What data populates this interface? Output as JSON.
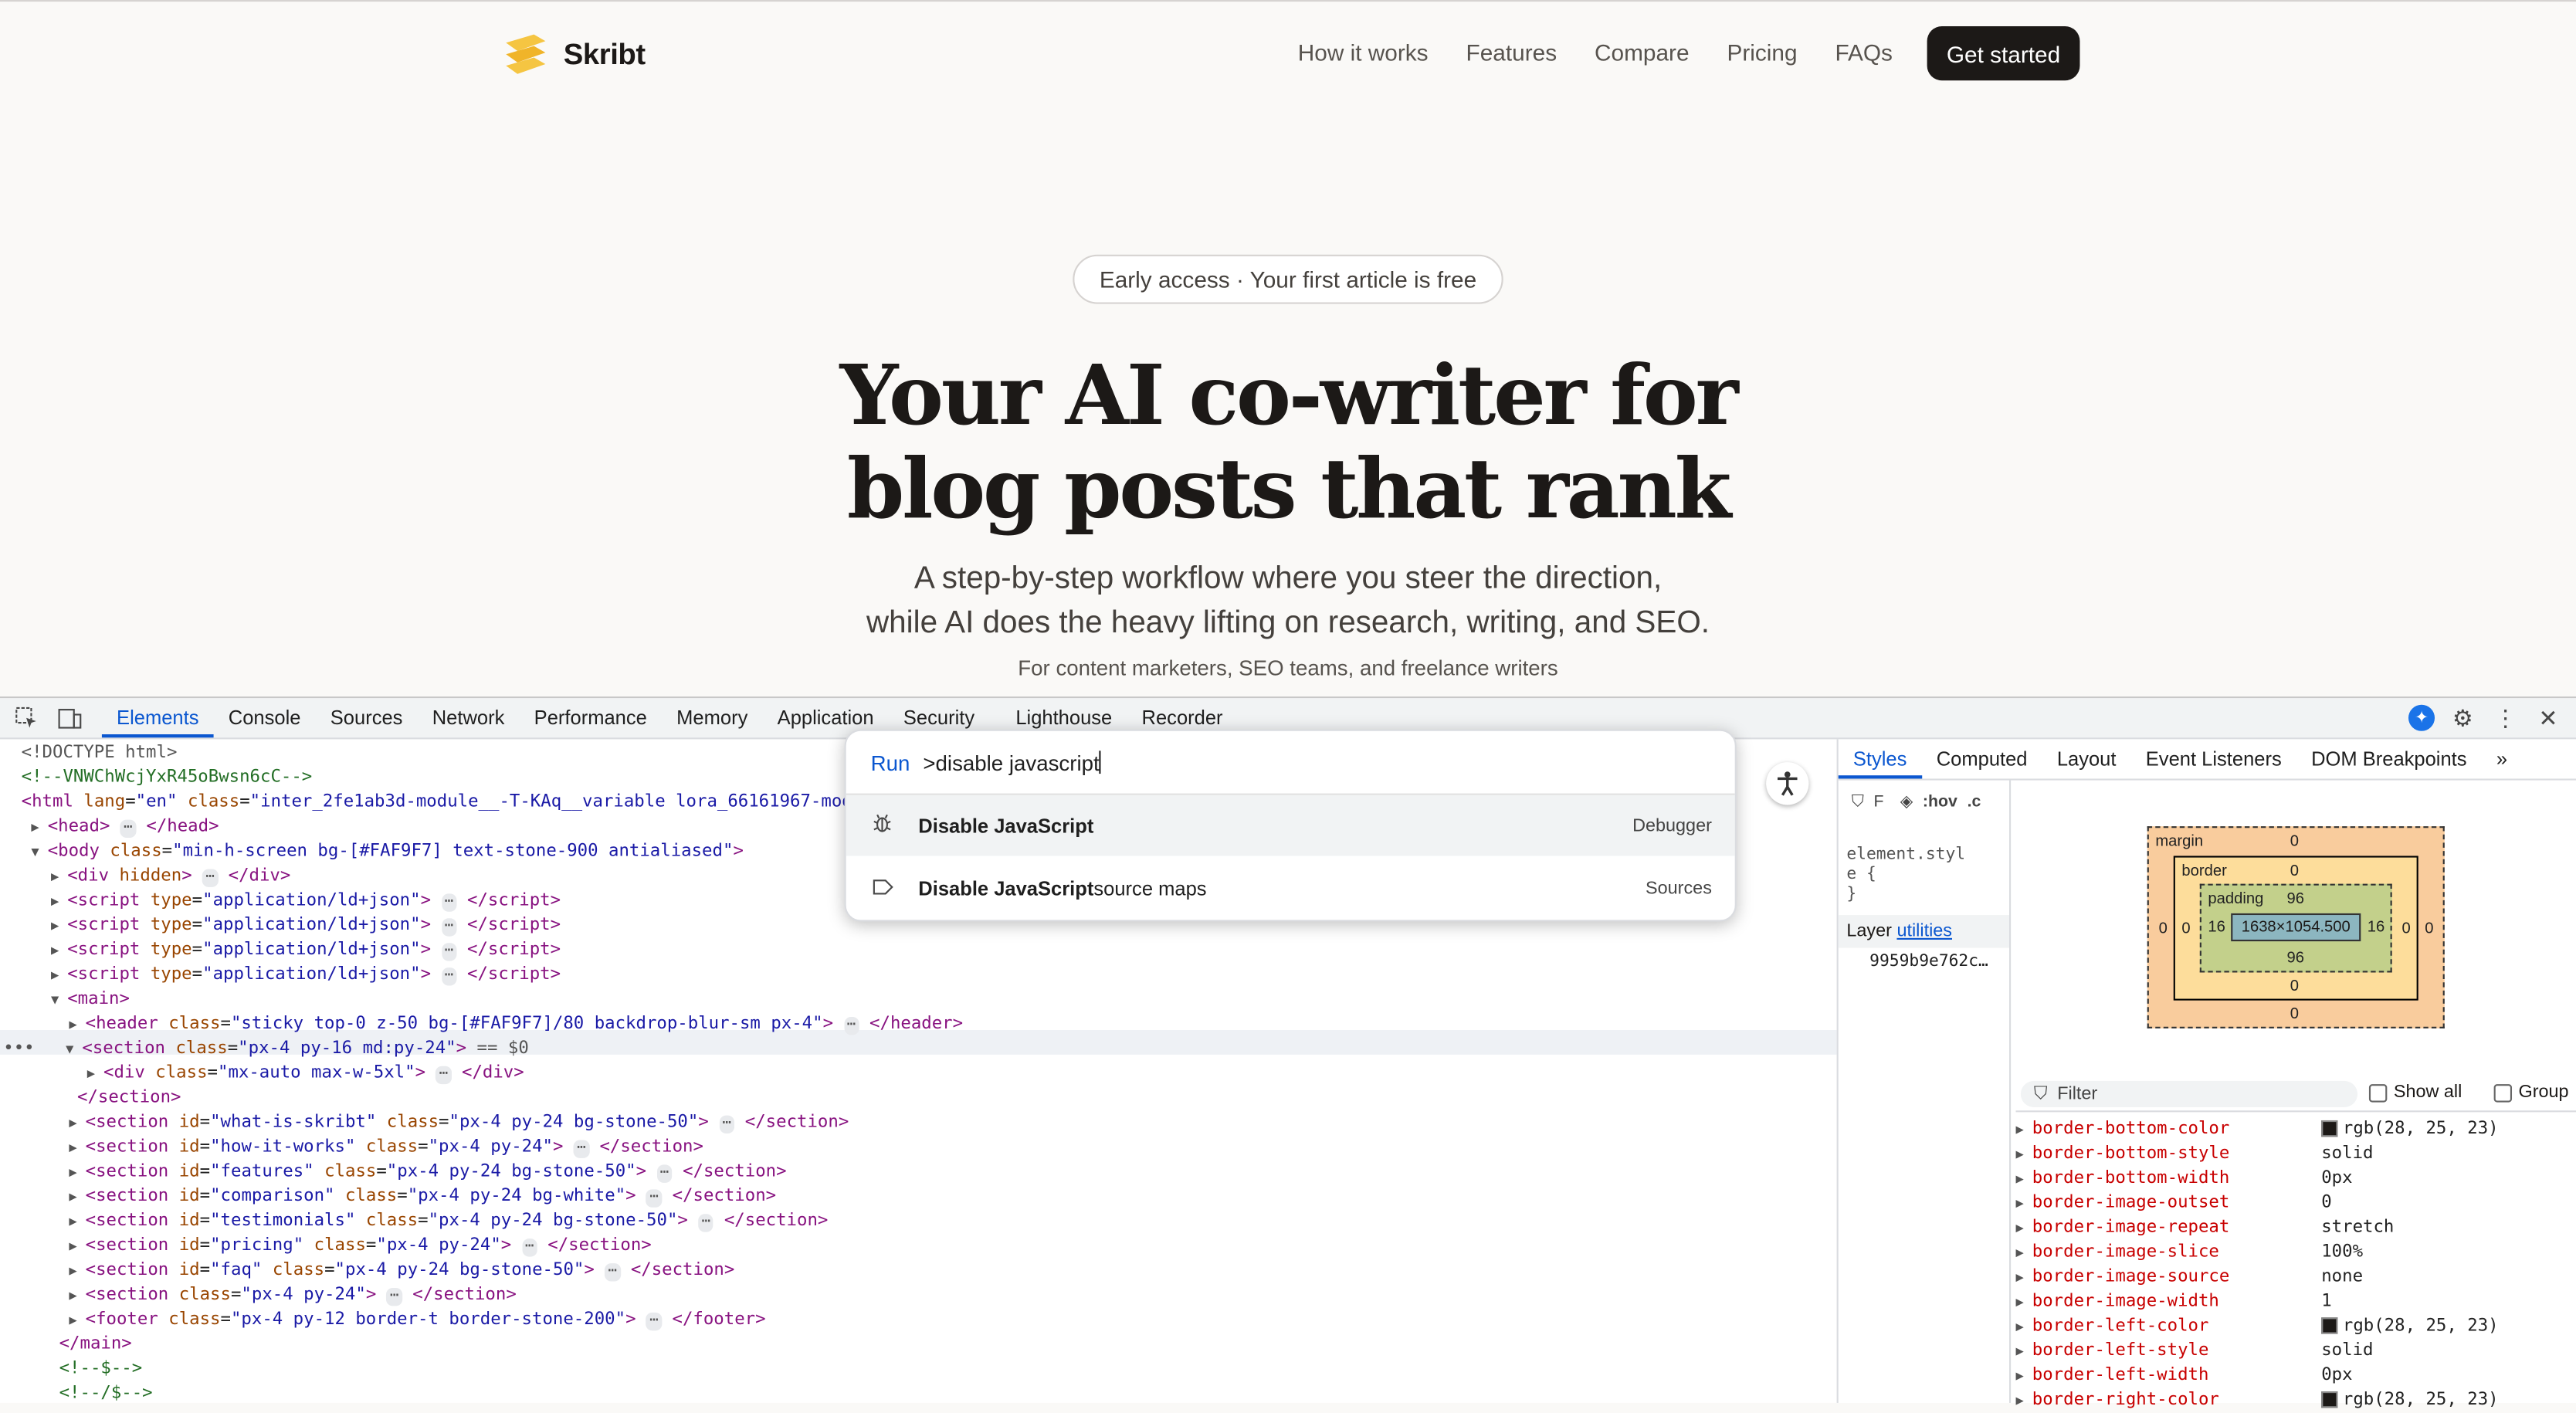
{
  "site": {
    "brand": "Skribt",
    "nav": [
      "How it works",
      "Features",
      "Compare",
      "Pricing",
      "FAQs"
    ],
    "cta": "Get started",
    "badge": "Early access · Your first article is free",
    "title_line1": "Your AI co-writer for",
    "title_line2": "blog posts that rank",
    "sub_line1": "A step-by-step workflow where you steer the direction,",
    "sub_line2": "while AI does the heavy lifting on research, writing, and SEO.",
    "note": "For content marketers, SEO teams, and freelance writers",
    "colors": {
      "bg": "#FAF9F7",
      "logo": "#F5C542",
      "cta_bg": "#1C1917"
    }
  },
  "devtools": {
    "tabs": [
      "Elements",
      "Console",
      "Sources",
      "Network",
      "Performance",
      "Memory",
      "Application",
      "Security",
      "Lighthouse",
      "Recorder"
    ],
    "dom": {
      "l0": "<!DOCTYPE html>",
      "l1": "<!--VNWChWcjYxR45oBwsn6cC-->",
      "l2_attr": "inter_2fe1ab3d-module__-T-KAq__variable lora_66161967-modu",
      "l4_attr": "min-h-screen bg-[#FAF9F7] text-stone-900 antialiased",
      "ld": "application/ld+json",
      "header_attr": "sticky top-0 z-50 bg-[#FAF9F7]/80 backdrop-blur-sm px-4",
      "section_attr": "px-4 py-16 md:py-24",
      "selected_marker": "== $0",
      "div_attr": "mx-auto max-w-5xl",
      "sections": [
        {
          "id": "what-is-skribt",
          "cls": "px-4 py-24 bg-stone-50"
        },
        {
          "id": "how-it-works",
          "cls": "px-4 py-24"
        },
        {
          "id": "features",
          "cls": "px-4 py-24 bg-stone-50"
        },
        {
          "id": "comparison",
          "cls": "px-4 py-24 bg-white"
        },
        {
          "id": "testimonials",
          "cls": "px-4 py-24 bg-stone-50"
        },
        {
          "id": "pricing",
          "cls": "px-4 py-24"
        },
        {
          "id": "faq",
          "cls": "px-4 py-24 bg-stone-50"
        }
      ],
      "section_plain": "px-4 py-24",
      "footer_attr": "px-4 py-12 border-t border-stone-200",
      "c1": "<!--$-->",
      "c2": "<!--/$-->"
    },
    "command_menu": {
      "prefix": "Run",
      "query": ">disable javascript",
      "items": [
        {
          "bold": "Disable JavaScript",
          "rest": "",
          "category": "Debugger",
          "icon": "bug-icon"
        },
        {
          "bold": "Disable JavaScript",
          "rest": " source maps",
          "category": "Sources",
          "icon": "tag-icon"
        }
      ]
    },
    "side_tabs": [
      "Styles",
      "Computed",
      "Layout",
      "Event Listeners",
      "DOM Breakpoints"
    ],
    "styles": {
      "filter_placeholder": "F",
      "hov": ":hov",
      "cls": ".c",
      "element_style_1": "element.styl",
      "element_style_2": "e {",
      "element_style_3": "}",
      "layer_prefix": "Layer",
      "layer_link": "utilities",
      "layer_hash": "9959b9e762c…"
    },
    "box_model": {
      "margin_label": "margin",
      "margin_top": "0",
      "margin_bottom": "0",
      "margin_left": "0",
      "margin_right": "0",
      "border_label": "border",
      "border_top": "0",
      "border_bottom": "0",
      "border_left": "0",
      "border_right": "0",
      "padding_label": "padding",
      "padding_top": "96",
      "padding_bottom": "96",
      "padding_left": "16",
      "padding_right": "16",
      "content": "1638×1054.500"
    },
    "computed": {
      "filter_placeholder": "Filter",
      "show_all": "Show all",
      "group": "Group",
      "props": [
        {
          "name": "border-bottom-color",
          "value": "rgb(28, 25, 23)",
          "swatch": true
        },
        {
          "name": "border-bottom-style",
          "value": "solid"
        },
        {
          "name": "border-bottom-width",
          "value": "0px"
        },
        {
          "name": "border-image-outset",
          "value": "0"
        },
        {
          "name": "border-image-repeat",
          "value": "stretch"
        },
        {
          "name": "border-image-slice",
          "value": "100%"
        },
        {
          "name": "border-image-source",
          "value": "none"
        },
        {
          "name": "border-image-width",
          "value": "1"
        },
        {
          "name": "border-left-color",
          "value": "rgb(28, 25, 23)",
          "swatch": true
        },
        {
          "name": "border-left-style",
          "value": "solid"
        },
        {
          "name": "border-left-width",
          "value": "0px"
        },
        {
          "name": "border-right-color",
          "value": "rgb(28, 25, 23)",
          "swatch": true
        }
      ]
    }
  }
}
